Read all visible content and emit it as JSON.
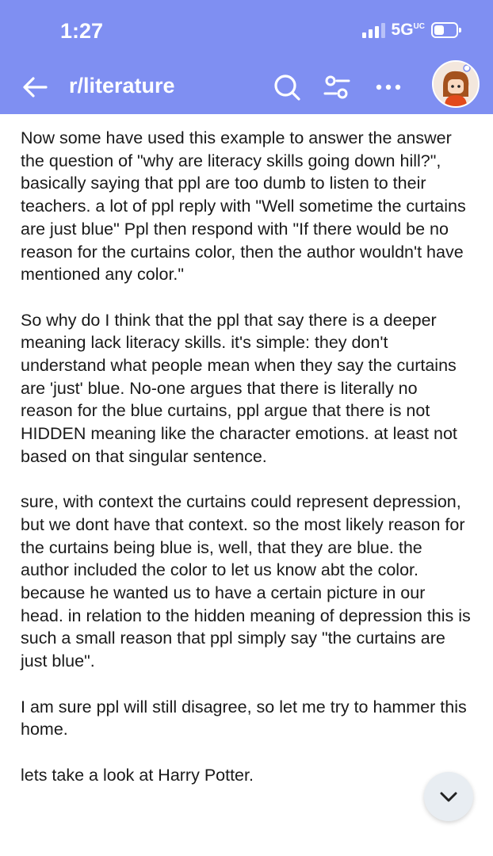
{
  "status_bar": {
    "time": "1:27",
    "network": "5G",
    "network_sup": "UC"
  },
  "header": {
    "title": "r/literature",
    "icons": [
      "back-arrow-icon",
      "search-icon",
      "filter-icon",
      "more-icon",
      "avatar"
    ]
  },
  "colors": {
    "header_bg": "#7f8ff2",
    "text": "#1a1a1a",
    "fab_bg": "#e8edf2"
  },
  "post": {
    "paragraphs": [
      "Now some have used this example to answer the answer the question of \"why are literacy skills going down hill?\", basically saying that ppl are too dumb to listen to their teachers. a lot of ppl reply with \"Well sometime the curtains are just blue\" Ppl then respond with \"If there would be no reason for the curtains color, then the author wouldn't have mentioned any color.\"",
      "So why do I think that the ppl that say there is a deeper meaning lack literacy skills. it's simple: they don't understand what people mean when they say the curtains are 'just' blue. No-one argues that there is literally no reason for the blue curtains, ppl argue that there is not HIDDEN meaning like the character emotions. at least not based on that singular sentence.",
      "sure, with context the curtains could represent depression, but we dont have that context. so the most likely reason for the curtains being blue is, well, that they are blue. the author included the color to let us know abt the color. because he wanted us to have a certain picture in our head. in relation to the hidden meaning of depression this is such a small reason that ppl simply say \"the curtains are just blue\".",
      "I am sure ppl will still disagree, so let me try to hammer this home.",
      "lets take a look at Harry Potter."
    ]
  },
  "fab": {
    "icon": "chevron-down-icon"
  }
}
